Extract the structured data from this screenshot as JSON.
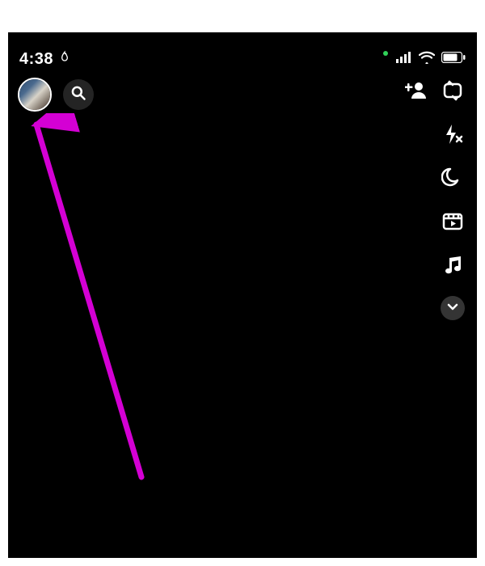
{
  "status_bar": {
    "time": "4:38",
    "streak_icon": "flame-icon",
    "privacy_indicator": "green",
    "signal_icon": "cellular-signal-icon",
    "wifi_icon": "wifi-icon",
    "battery_icon": "battery-icon"
  },
  "top_left": {
    "avatar_label": "profile-avatar",
    "search_label": "search"
  },
  "top_right": {
    "add_friend_label": "add-friend"
  },
  "tool_rail": {
    "items": [
      {
        "name": "flip-camera-icon"
      },
      {
        "name": "flash-off-icon"
      },
      {
        "name": "night-mode-icon"
      },
      {
        "name": "video-clip-icon"
      },
      {
        "name": "music-icon"
      }
    ],
    "collapse_label": "collapse"
  },
  "annotation": {
    "arrow_color": "#d400d4",
    "target": "profile-avatar"
  }
}
